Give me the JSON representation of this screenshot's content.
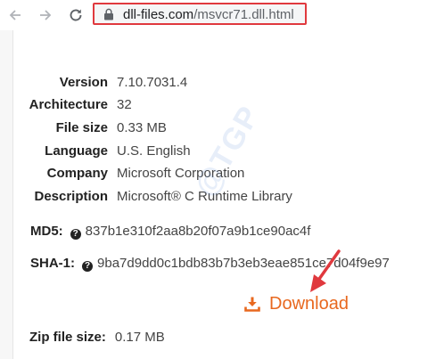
{
  "browser": {
    "url_domain": "dll-files.com",
    "url_path": "/msvcr71.dll.html",
    "back_icon": "back-arrow-icon",
    "forward_icon": "forward-arrow-icon",
    "reload_icon": "reload-icon",
    "lock_icon": "lock-icon"
  },
  "file_info": {
    "rows": [
      {
        "label": "Version",
        "value": "7.10.7031.4"
      },
      {
        "label": "Architecture",
        "value": "32"
      },
      {
        "label": "File size",
        "value": "0.33 MB"
      },
      {
        "label": "Language",
        "value": "U.S. English"
      },
      {
        "label": "Company",
        "value": "Microsoft Corporation"
      },
      {
        "label": "Description",
        "value": "Microsoft® C Runtime Library"
      }
    ],
    "md5_label": "MD5:",
    "md5_value": "837b1e310f2aa8b20f07a9b1ce90ac4f",
    "sha1_label": "SHA-1:",
    "sha1_value": "9ba7d9dd0c1bdb83b7b3eb3eae851ce7d04f9e97",
    "download_label": "Download",
    "zip_label": "Zip file size:",
    "zip_value": "0.17 MB"
  },
  "watermark": "@TGP",
  "colors": {
    "highlight_border": "#e0393e",
    "download": "#e8681f",
    "arrow": "#e0393e"
  }
}
